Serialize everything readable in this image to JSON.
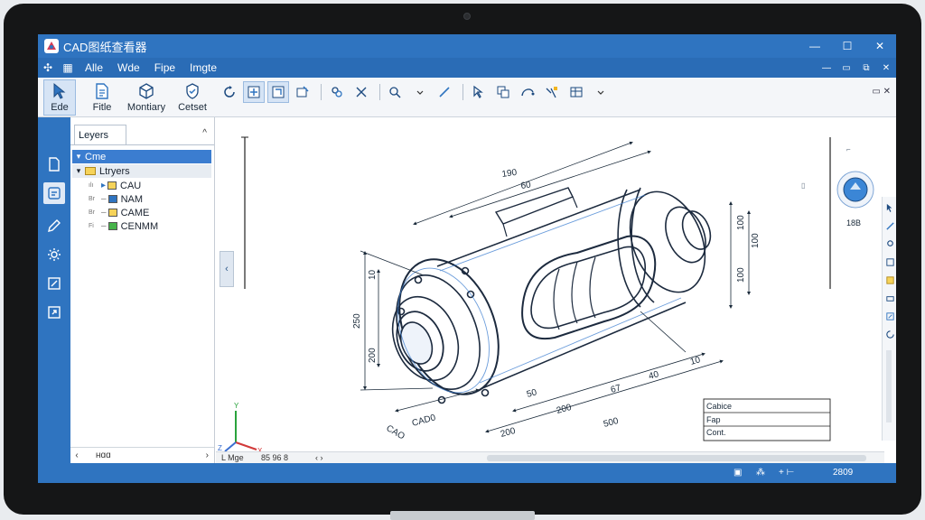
{
  "window": {
    "title": "CAD图纸查看器",
    "controls": [
      "—",
      "☐",
      "✕"
    ]
  },
  "menu": {
    "items": [
      "Alle",
      "Wde",
      "Fipe",
      "Imgte"
    ],
    "controls": [
      "—",
      "▭",
      "⧉",
      "✕"
    ]
  },
  "ribbon": {
    "buttons": [
      {
        "label": "Ede",
        "icon": "cursor-icon"
      },
      {
        "label": "Fitle",
        "icon": "document-icon"
      },
      {
        "label": "Montiary",
        "icon": "cube-icon"
      },
      {
        "label": "Cetset",
        "icon": "shield-icon"
      }
    ],
    "right_label": "▭ ✕"
  },
  "panel": {
    "tab_label": "Leyers",
    "collapse": "^",
    "tree": [
      {
        "label": "Cme",
        "prefix": "▾",
        "state": "selected"
      },
      {
        "label": "Ltryers",
        "prefix": "▾",
        "state": "group"
      },
      {
        "label": "CAU",
        "prefix": "ılı",
        "color": "#f6d35a"
      },
      {
        "label": "NAM",
        "prefix": "Br",
        "color": "#2f74c0"
      },
      {
        "label": "CAME",
        "prefix": "Br",
        "color": "#f6d35a"
      },
      {
        "label": "CENMM",
        "prefix": "Fi",
        "color": "#47b34a"
      }
    ],
    "footer_left": "‹",
    "footer_text": "ʜɑɑ",
    "footer_right": "›"
  },
  "drawing": {
    "dims_top": [
      "190",
      "60"
    ],
    "dims_left": [
      "10",
      "250",
      "200"
    ],
    "dims_right": [
      "100",
      "100",
      "100"
    ],
    "dims_bottom": [
      "10",
      "40",
      "67",
      "500",
      "200",
      "50",
      "200"
    ],
    "dims_lower_left": [
      "CAO",
      "CAD0"
    ],
    "axis_labels": [
      "Y",
      "Z",
      "X"
    ],
    "view_label": "18B"
  },
  "titleblock": {
    "rows": [
      "Cabice",
      "Fap",
      "Cont."
    ]
  },
  "canvas_status": {
    "left": "L Mge",
    "coords": "85 96 8",
    "nav": "‹ ›"
  },
  "statusbar": {
    "right": "2809",
    "mid": "+ ⊢"
  },
  "colors": {
    "accent": "#2f74c0",
    "bezel": "#151617"
  }
}
